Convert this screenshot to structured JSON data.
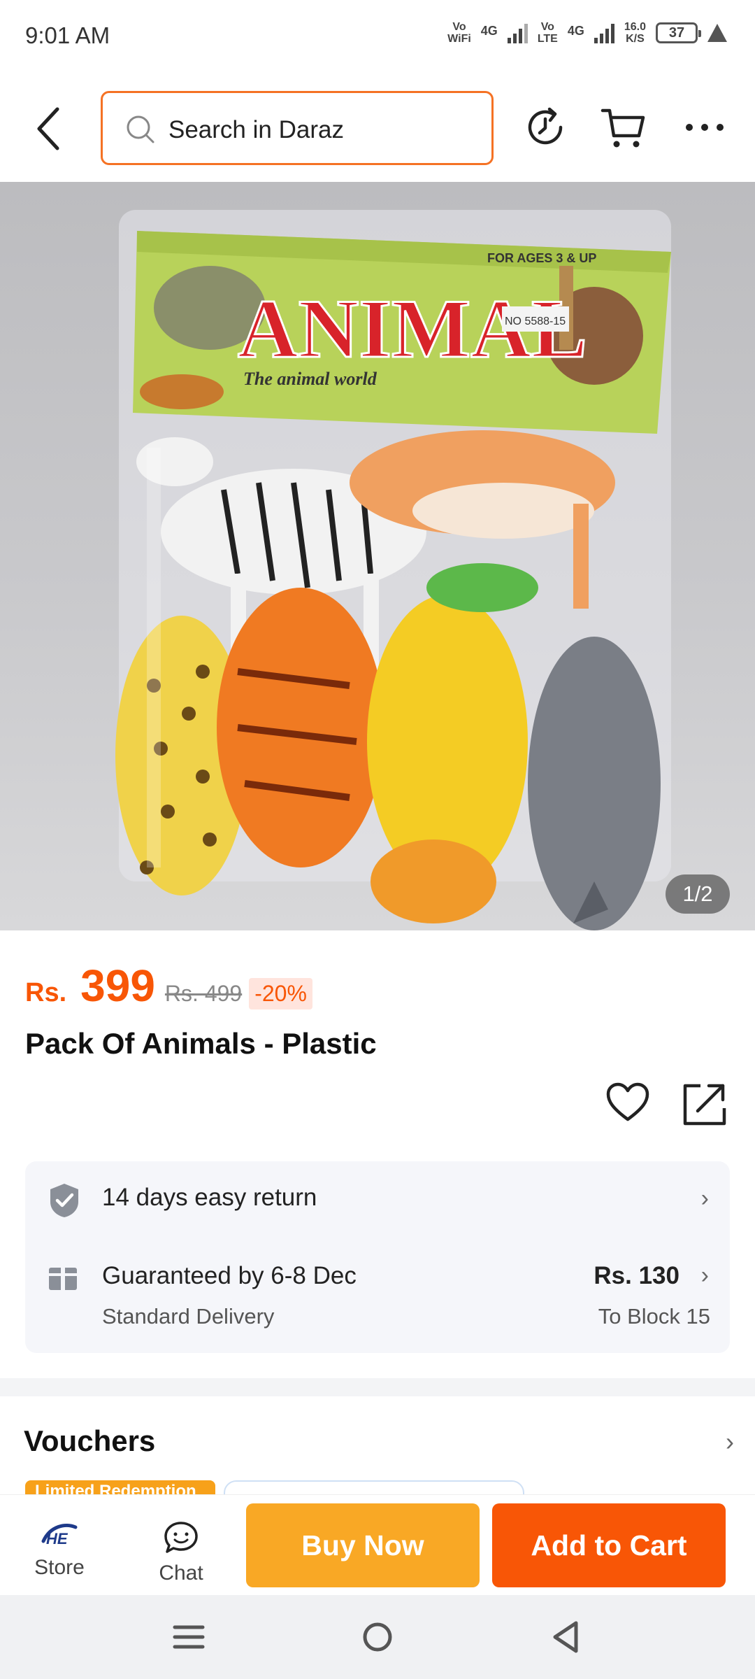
{
  "status_bar": {
    "time": "9:01 AM",
    "net1_top": "Vo",
    "net1_bottom": "WiFi",
    "gen1": "4G",
    "net2_top": "Vo",
    "net2_bottom": "LTE",
    "gen2": "4G",
    "speed_value": "16.0",
    "speed_unit": "K/S",
    "battery": "37"
  },
  "header": {
    "search_placeholder": "Search in Daraz"
  },
  "gallery": {
    "pager": "1/2",
    "packaging_text": "ANIMAL",
    "packaging_subtitle": "The animal world",
    "packaging_age": "FOR AGES 3 & UP",
    "packaging_code": "NO 5588-15"
  },
  "product": {
    "currency": "Rs.",
    "price": "399",
    "original_price": "Rs. 499",
    "discount": "-20%",
    "title": "Pack Of Animals - Plastic"
  },
  "services": {
    "return_text": "14 days easy return",
    "delivery_guarantee": "Guaranteed by 6-8 Dec",
    "delivery_type": "Standard Delivery",
    "delivery_fee": "Rs. 130",
    "delivery_destination": "To Block 15"
  },
  "vouchers": {
    "title": "Vouchers",
    "tag": "Limited Redemption"
  },
  "bottom_bar": {
    "store_label": "Store",
    "chat_label": "Chat",
    "buy_now": "Buy Now",
    "add_to_cart": "Add to Cart"
  },
  "colors": {
    "brand_orange": "#f85606",
    "buy_yellow": "#f9a825",
    "search_border": "#f57224"
  }
}
